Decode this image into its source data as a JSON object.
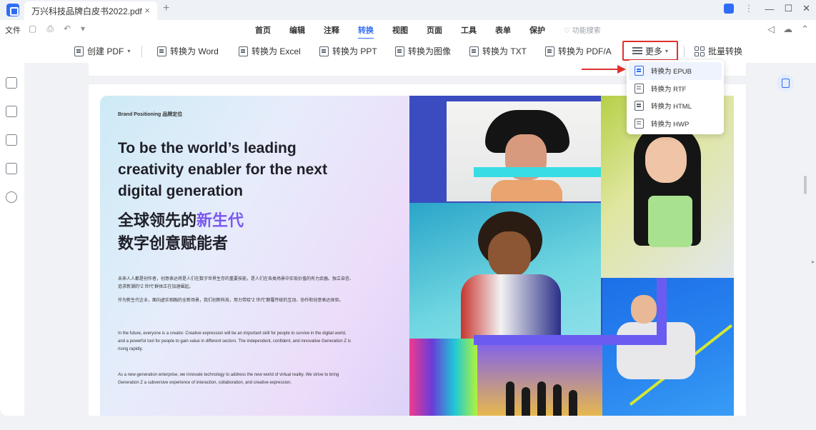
{
  "titlebar": {
    "doc_tab": "万兴科技品牌白皮书2022.pdf",
    "tab_close": "×",
    "new_tab": "+"
  },
  "menubar": {
    "file": "文件",
    "tabs": [
      "首页",
      "编辑",
      "注释",
      "转换",
      "视图",
      "页面",
      "工具",
      "表单",
      "保护"
    ],
    "active_tab": "转换",
    "search": "功能搜索"
  },
  "toolbar": {
    "create_pdf": "创建 PDF",
    "to_word": "转换为 Word",
    "to_excel": "转换为 Excel",
    "to_ppt": "转换为 PPT",
    "to_image": "转换为图像",
    "to_txt": "转换为 TXT",
    "to_pdfa": "转换为 PDF/A",
    "more": "更多",
    "batch": "批量转换"
  },
  "dropdown": {
    "items": [
      "转换为 EPUB",
      "转换为 RTF",
      "转换为 HTML",
      "转换为 HWP"
    ]
  },
  "document": {
    "brand_label": "Brand Positioning  品牌定位",
    "headline": "To be the world’s leading creativity enabler for the next digital generation",
    "cn_title_prefix": "全球领先的",
    "cn_title_highlight": "新生代",
    "cn_title_line2": "数字创意赋能者",
    "para1": "未来人人都是创作者，创意表达将是人们在数字世界生存的重要技能，是人们在各类场景中实现价值的有力武器。独立自信、追求新潮的“Z 世代”群体正在加速崛起。",
    "para2": "作为新生代企业，面向虚实相融的全新场景，我们创新科技，努力带给“Z 世代”颠覆传统的互动、协作和创意表达体验。",
    "para3": "In the future, everyone is a creator. Creative expression will be an important skill for people to survive in the digital world, and a powerful tool for people to gain value in different sectors. The independent, confident, and innovative Generation Z is rising rapidly.",
    "para4": "As a new-generation enterprise, we innovate technology to address the new world of virtual reality. We strive to bring Generation Z a subversive experience of interaction, collaboration, and creative expression."
  },
  "colors": {
    "accent": "#2f6df5",
    "highlight_red": "#e0312f",
    "highlight_purple": "#7a58f0"
  }
}
